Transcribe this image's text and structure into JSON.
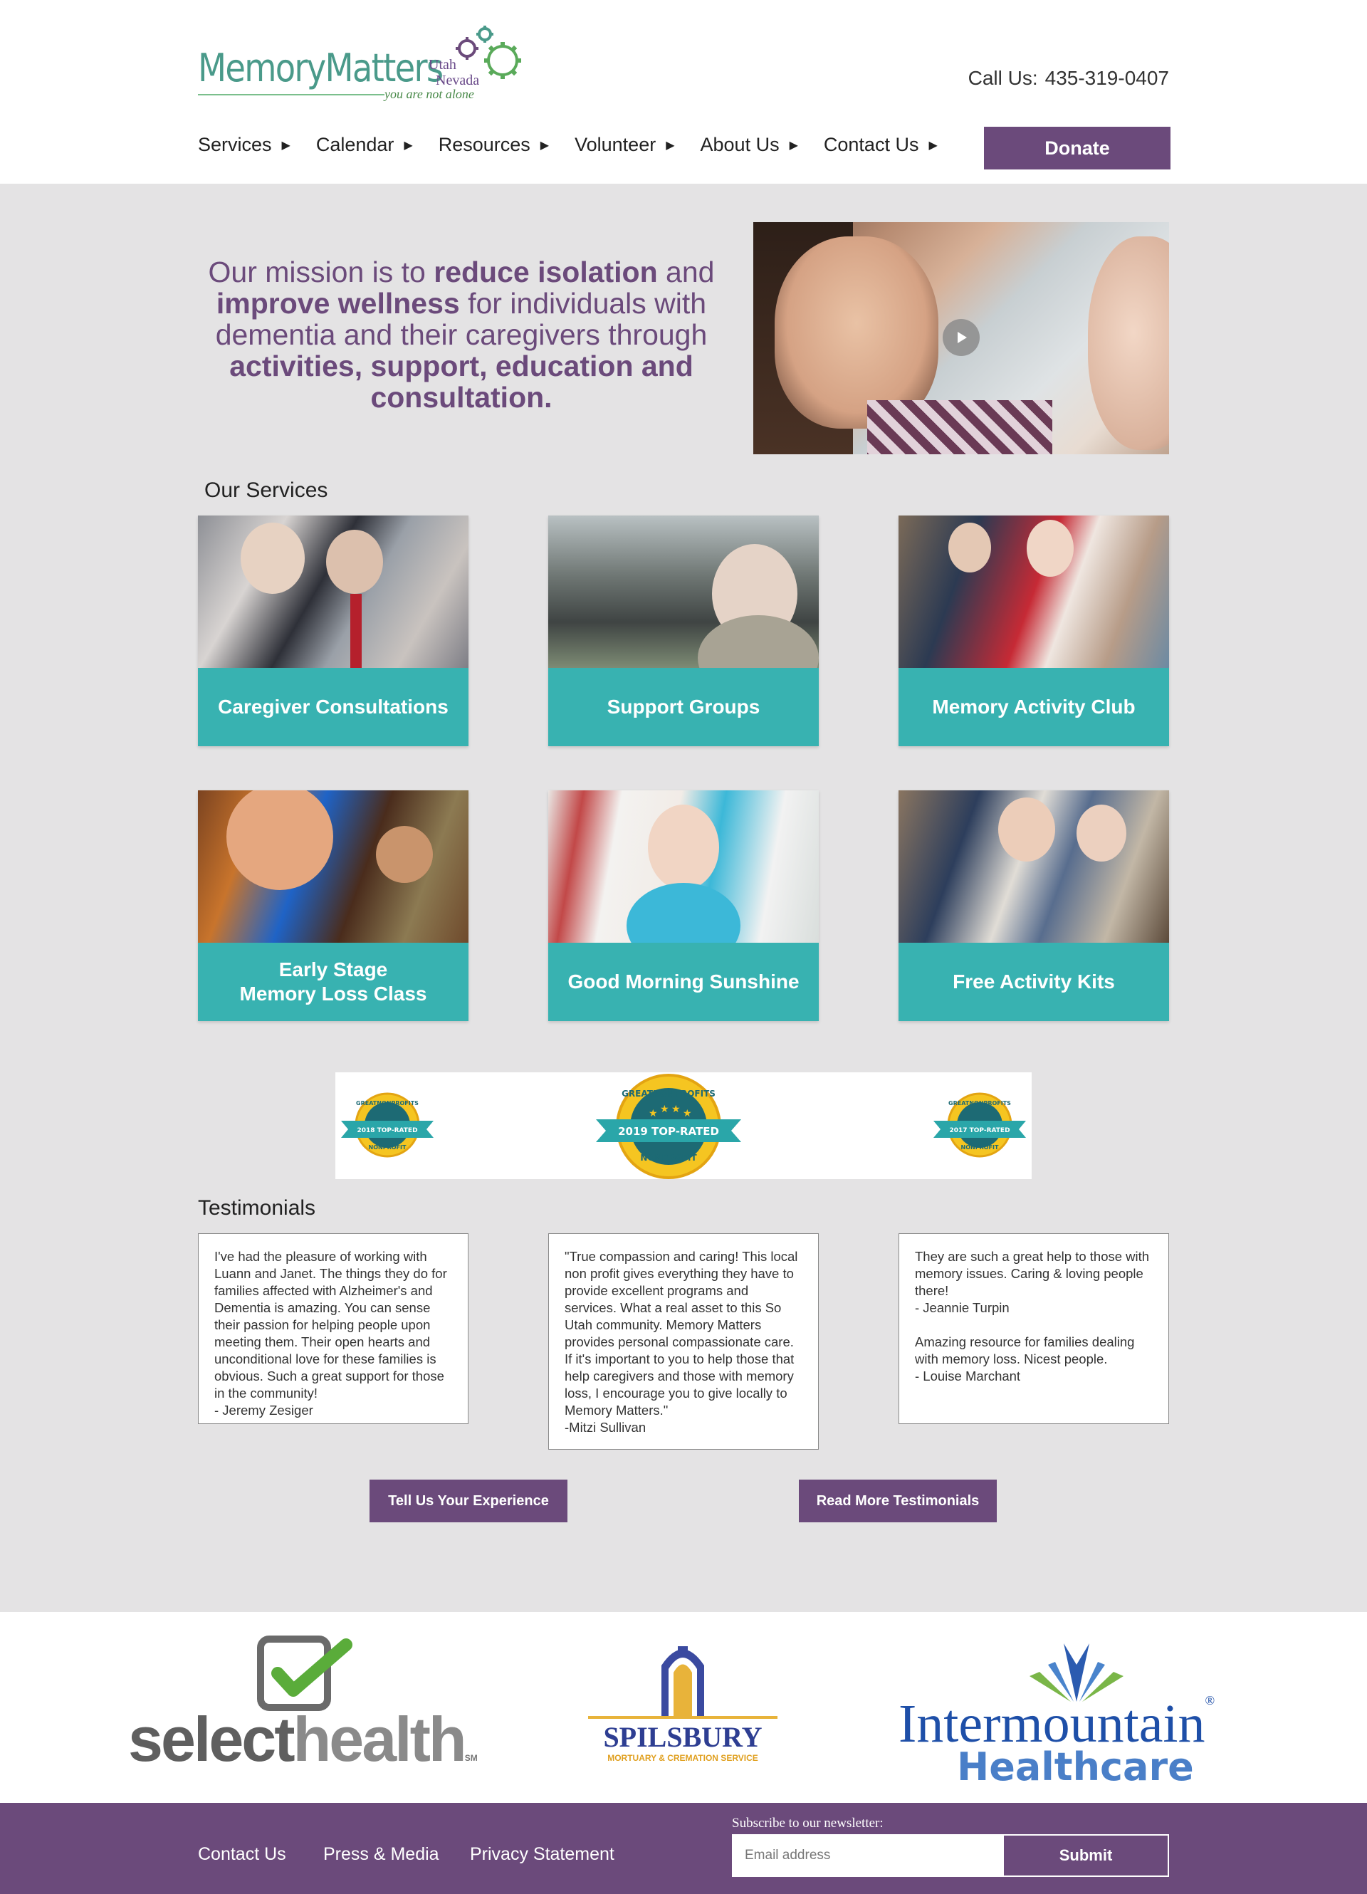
{
  "header": {
    "logo": {
      "name": "MemoryMatters",
      "region_line1": "Utah",
      "region_line2": "Nevada",
      "tagline": "you are not alone"
    },
    "call_us_label": "Call Us:",
    "phone": "435-319-0407",
    "nav": [
      {
        "label": "Services"
      },
      {
        "label": "Calendar"
      },
      {
        "label": "Resources"
      },
      {
        "label": "Volunteer"
      },
      {
        "label": "About Us"
      },
      {
        "label": "Contact Us"
      }
    ],
    "donate_label": "Donate"
  },
  "mission": {
    "p1": "Our mission is to ",
    "b1": "reduce isolation",
    "p2": " and ",
    "b2": "improve wellness",
    "p3": " for individuals with dementia and their caregivers through ",
    "b3": "activities, support, education and consultation."
  },
  "services": {
    "title": "Our Services",
    "items": [
      {
        "label": "Caregiver Consultations"
      },
      {
        "label": "Support Groups"
      },
      {
        "label": "Memory Activity Club"
      },
      {
        "label": "Early Stage\nMemory Loss Class"
      },
      {
        "label": "Good Morning Sunshine"
      },
      {
        "label": "Free Activity Kits"
      }
    ]
  },
  "badges": [
    {
      "top": "GREATNONPROFITS",
      "banner": "2018 TOP-RATED",
      "bottom": "NONPROFIT"
    },
    {
      "top": "GREATNONPROFITS",
      "banner": "2019 TOP-RATED",
      "bottom": "NONPROFIT"
    },
    {
      "top": "GREATNONPROFITS",
      "banner": "2017 TOP-RATED",
      "bottom": "NONPROFIT"
    }
  ],
  "testimonials": {
    "title": "Testimonials",
    "items": [
      {
        "text": "I've had the pleasure of working with Luann and Janet. The things they do for families affected with Alzheimer's and Dementia is amazing. You can sense their passion for helping people upon meeting them. Their open hearts and unconditional love for these families is obvious.  Such a great support for those in the community!\n- Jeremy Zesiger"
      },
      {
        "text": "\"True compassion and caring!  This local non profit gives everything they have to provide excellent programs and services. What a real asset to this So Utah community. Memory Matters provides personal compassionate care. If it's important to you to help those that help caregivers and those with memory loss, I encourage you to give locally to Memory Matters.\"\n-Mitzi Sullivan"
      },
      {
        "text": "They are such a great help to those with memory issues. Caring & loving people there!\n- Jeannie Turpin\n\nAmazing resource for families dealing with memory loss. Nicest people.\n- Louise Marchant"
      }
    ],
    "tell_label": "Tell Us Your Experience",
    "read_more_label": "Read More Testimonials"
  },
  "sponsors": {
    "selecthealth": {
      "select": "select",
      "health": "health",
      "mark": "SM"
    },
    "spilsbury": {
      "name": "SPILSBURY",
      "sub": "MORTUARY & CREMATION SERVICE"
    },
    "intermountain": {
      "line1": "Intermountain",
      "line2": "Healthcare",
      "mark": "®"
    }
  },
  "footer": {
    "links": [
      {
        "label": "Contact Us"
      },
      {
        "label": "Press & Media"
      },
      {
        "label": "Privacy Statement"
      }
    ],
    "newsletter_label": "Subscribe to our newsletter:",
    "email_placeholder": "Email address",
    "submit_label": "Submit"
  },
  "colors": {
    "purple": "#6b4a7b",
    "teal": "#38b2b1",
    "grey_bg": "#e4e3e4",
    "logo_green": "#4a9a8a"
  }
}
